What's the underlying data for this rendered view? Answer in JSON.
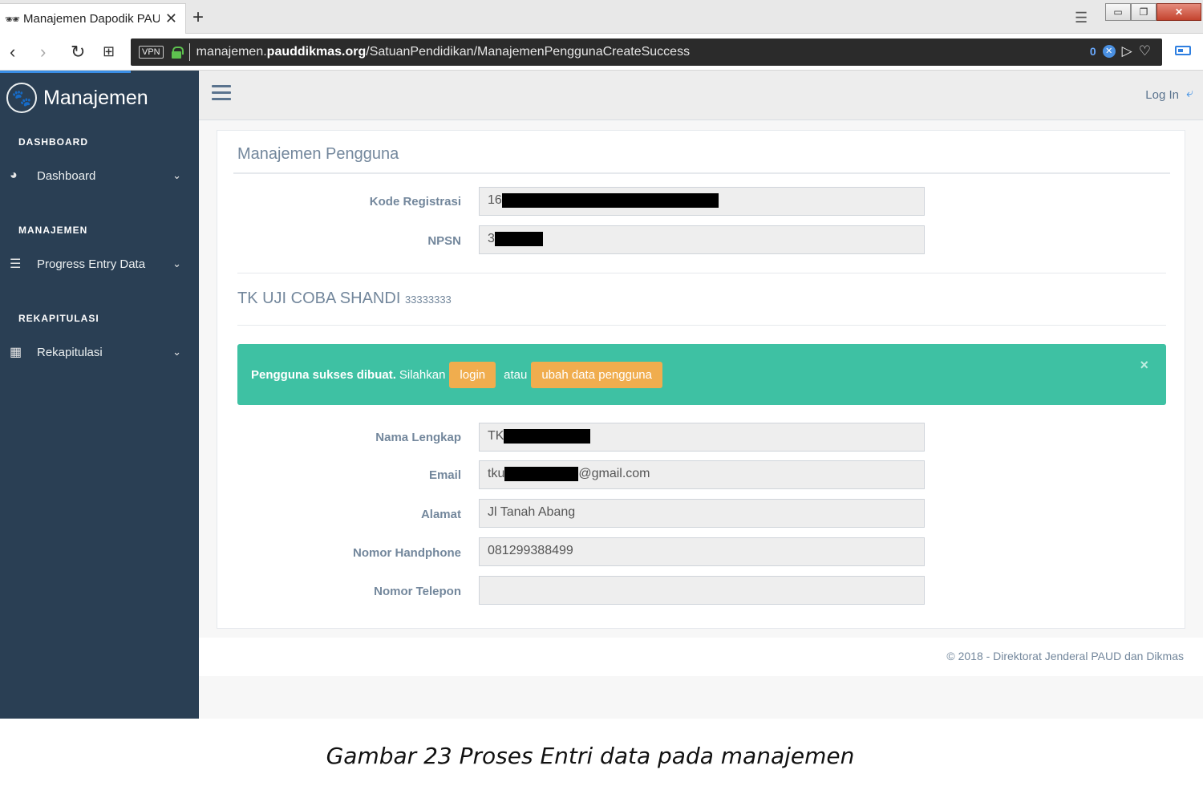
{
  "browser": {
    "tab_icon": "incognito-icon",
    "tab_title": "Manajemen Dapodik PAUI",
    "close_tab": "✕",
    "new_tab": "+",
    "tabbar_menu": "⩯",
    "vpn_label": "VPN",
    "url_host": "manajemen.",
    "url_domain": "pauddikmas.org",
    "url_path": "/SatuanPendidikan/ManajemenPenggunaCreateSuccess",
    "blocker_count": "0"
  },
  "sidebar": {
    "brand": "Manajemen",
    "brand_icon": "paw-icon",
    "sections": [
      {
        "title": "DASHBOARD",
        "item": "Dashboard",
        "icon": "tachometer-icon"
      },
      {
        "title": "MANAJEMEN",
        "item": "Progress Entry Data",
        "icon": "server-icon"
      },
      {
        "title": "REKAPITULASI",
        "item": "Rekapitulasi",
        "icon": "table-icon"
      }
    ]
  },
  "topnav": {
    "login": "Log In"
  },
  "panel": {
    "title": "Manajemen Pengguna",
    "kode_registrasi_label": "Kode Registrasi",
    "kode_registrasi_value": "16",
    "npsn_label": "NPSN",
    "npsn_value": "3",
    "school_name": "TK UJI COBA SHANDI",
    "school_code": "33333333",
    "alert": {
      "strong": "Pengguna sukses dibuat.",
      "text": "Silahkan",
      "login_button": "login",
      "atau": "atau",
      "edit_button": "ubah data pengguna",
      "close": "×",
      "color": "#3ec1a3"
    },
    "nama_label": "Nama Lengkap",
    "nama_value": "TK",
    "email_label": "Email",
    "email_prefix": "tku",
    "email_suffix": "@gmail.com",
    "alamat_label": "Alamat",
    "alamat_value": "Jl Tanah Abang",
    "hp_label": "Nomor Handphone",
    "hp_value": "081299388499",
    "telepon_label": "Nomor Telepon",
    "telepon_value": ""
  },
  "footer": {
    "text": "©  2018 - Direktorat Jenderal PAUD dan Dikmas"
  },
  "caption": "Gambar 23 Proses Entri data pada manajemen"
}
